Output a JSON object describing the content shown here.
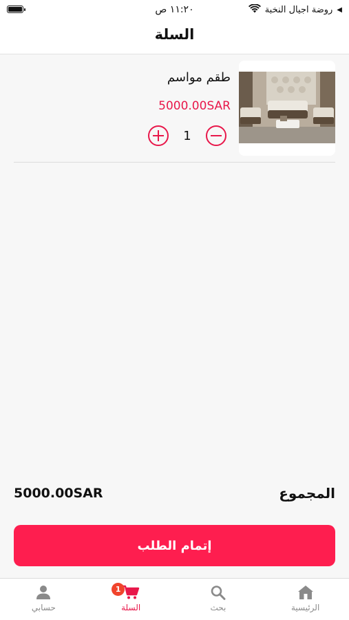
{
  "status_bar": {
    "carrier": "روضة اجيال النخبة",
    "time": "١١:٢٠ ص",
    "play_glyph": "◀",
    "icons": [
      "wifi-icon",
      "battery-icon"
    ]
  },
  "header": {
    "title": "السلة"
  },
  "cart": {
    "items": [
      {
        "name": "طقم مواسم",
        "price": "5000.00SAR",
        "quantity": "1"
      }
    ]
  },
  "summary": {
    "total_label": "المجموع",
    "total_value": "5000.00SAR"
  },
  "checkout": {
    "label": "إتمام الطلب"
  },
  "nav": {
    "items": [
      {
        "label": "الرئيسية",
        "icon": "home-icon"
      },
      {
        "label": "بحث",
        "icon": "search-icon"
      },
      {
        "label": "السلة",
        "icon": "cart-icon",
        "badge": "1",
        "active": true
      },
      {
        "label": "حسابي",
        "icon": "user-icon"
      }
    ]
  },
  "colors": {
    "accent": "#e8174a",
    "button": "#fe1e4f",
    "badge": "#f0442c"
  }
}
